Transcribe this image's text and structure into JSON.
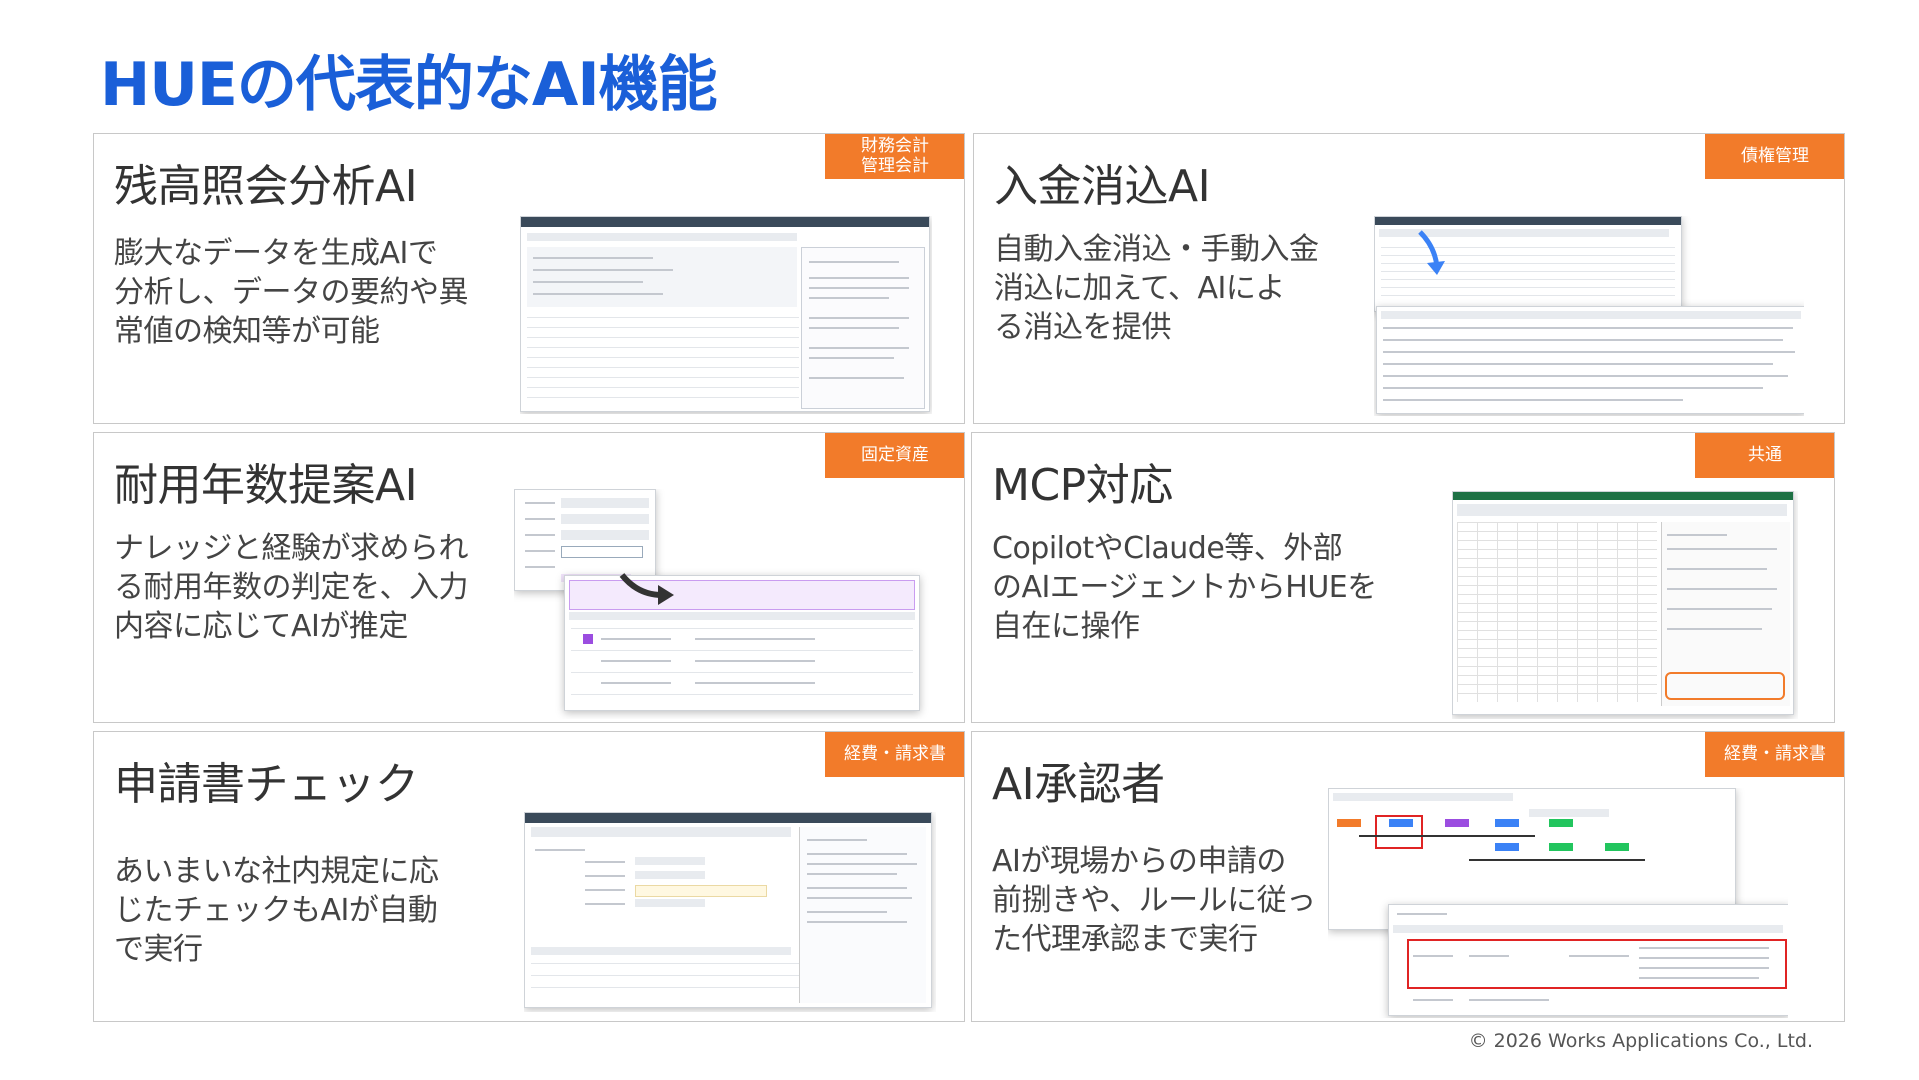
{
  "title": "HUEの代表的なAI機能",
  "cards": [
    {
      "title": "残高照会分析AI",
      "tag": "財務会計\n管理会計",
      "desc": "膨大なデータを生成AIで\n分析し、データの要約や異\n常値の検知等が可能"
    },
    {
      "title": "入金消込AI",
      "tag": "債権管理",
      "desc": "自動入金消込・手動入金\n消込に加えて、AIによ\nる消込を提供"
    },
    {
      "title": "耐用年数提案AI",
      "tag": "固定資産",
      "desc": "ナレッジと経験が求められ\nる耐用年数の判定を、入力\n内容に応じてAIが推定"
    },
    {
      "title": "MCP対応",
      "tag": "共通",
      "desc": "CopilotやClaude等、外部\nのAIエージェントからHUEを\n自在に操作"
    },
    {
      "title": "申請書チェック",
      "tag": "経費・請求書",
      "desc": "あいまいな社内規定に応\nじたチェックもAIが自動\nで実行"
    },
    {
      "title": "AI承認者",
      "tag": "経費・請求書",
      "desc": "AIが現場からの申請の\n前捌きや、ルールに従っ\nた代理承認まで実行"
    }
  ],
  "footer": "© 2026 Works Applications Co., Ltd.",
  "colors": {
    "title": "#1a5fd8",
    "tag": "#f27b2a",
    "highlight": "#e02424",
    "accent_purple": "#9b4de0",
    "excel_green": "#1e7145"
  }
}
